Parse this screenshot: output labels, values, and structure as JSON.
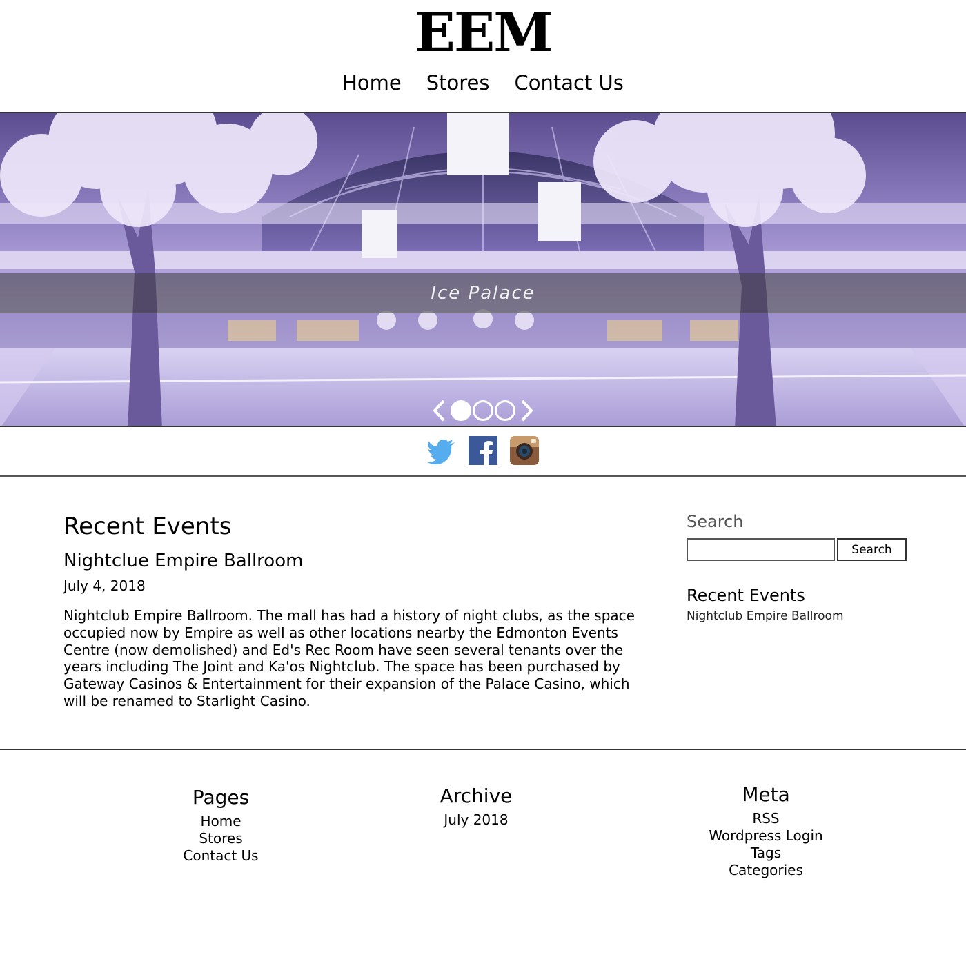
{
  "header": {
    "logo": "EEM",
    "nav": [
      "Home",
      "Stores",
      "Contact Us"
    ]
  },
  "hero": {
    "caption": "Ice Palace",
    "slides_total": 3,
    "active_slide": 1
  },
  "social": [
    "twitter-icon",
    "facebook-icon",
    "instagram-icon"
  ],
  "main": {
    "section_title": "Recent Events",
    "post": {
      "title": "Nightclue Empire Ballroom",
      "date": "July 4, 2018",
      "body": "Nightclub Empire Ballroom. The mall has had a history of night clubs, as the space occupied now by Empire as well as other locations nearby the Edmonton Events Centre (now demolished) and Ed's Rec Room have seen several tenants over the years including The Joint and Ka'os Nightclub. The space has been purchased by Gateway Casinos & Entertainment for their expansion of the Palace Casino, which will be renamed to Starlight Casino."
    }
  },
  "sidebar": {
    "search_title": "Search",
    "search_button": "Search",
    "search_value": "",
    "events_title": "Recent Events",
    "events": [
      "Nightclub Empire Ballroom"
    ]
  },
  "footer": {
    "pages": {
      "title": "Pages",
      "links": [
        "Home",
        "Stores",
        "Contact Us"
      ]
    },
    "archive": {
      "title": "Archive",
      "links": [
        "July 2018"
      ]
    },
    "meta": {
      "title": "Meta",
      "links": [
        "RSS",
        "Wordpress Login",
        "Tags",
        "Categories"
      ]
    }
  },
  "colors": {
    "twitter": "#55acee",
    "facebook": "#3b5998",
    "hero_tint": "#b8a9e0"
  }
}
